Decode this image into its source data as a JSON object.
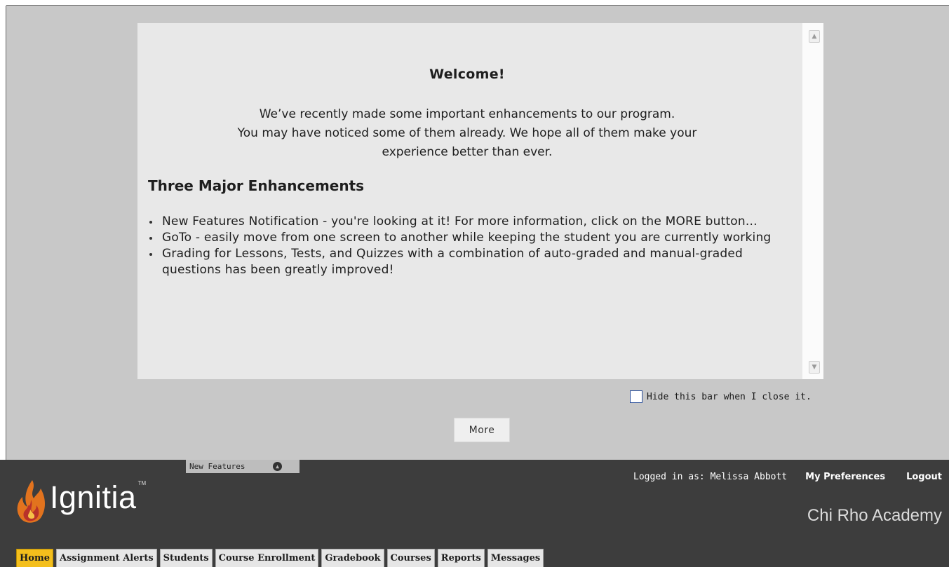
{
  "notice": {
    "title": "Welcome!",
    "intro_lines": [
      "We’ve recently made some important enhancements to our program.",
      "You may have noticed some of them already. We hope all of them make your",
      "experience better than ever."
    ],
    "section_heading": "Three Major Enhancements",
    "bullets": [
      "New Features Notification - you're looking at it! For more information, click on the MORE button...",
      "GoTo - easily move from one screen to another while keeping the student you are currently working",
      "Grading for Lessons, Tests, and Quizzes with a combination of auto-graded and manual-graded questions has been greatly improved!"
    ],
    "scroll_up_icon": "chevron-up-icon",
    "scroll_down_icon": "chevron-down-icon"
  },
  "hide_bar": {
    "label": "Hide this bar when I close it.",
    "checked": false
  },
  "more_button": {
    "label": "More"
  },
  "footer": {
    "new_features_tab": {
      "label": "New Features",
      "icon": "collapse-circle-icon"
    },
    "logo": {
      "text": "Ignitia",
      "tm": "TM"
    },
    "logged_in_text": "Logged in as: Melissa Abbott",
    "preferences_label": "My Preferences",
    "logout_label": "Logout",
    "school_name": "Chi Rho Academy",
    "tabs": [
      {
        "label": "Home",
        "active": true
      },
      {
        "label": "Assignment Alerts",
        "active": false
      },
      {
        "label": "Students",
        "active": false
      },
      {
        "label": "Course Enrollment",
        "active": false
      },
      {
        "label": "Gradebook",
        "active": false
      },
      {
        "label": "Courses",
        "active": false
      },
      {
        "label": "Reports",
        "active": false
      },
      {
        "label": "Messages",
        "active": false
      }
    ]
  },
  "colors": {
    "background": "#c8c8c8",
    "panel": "#e8e8e8",
    "footer": "#3d3d3d",
    "active_tab": "#f4bf1c"
  }
}
